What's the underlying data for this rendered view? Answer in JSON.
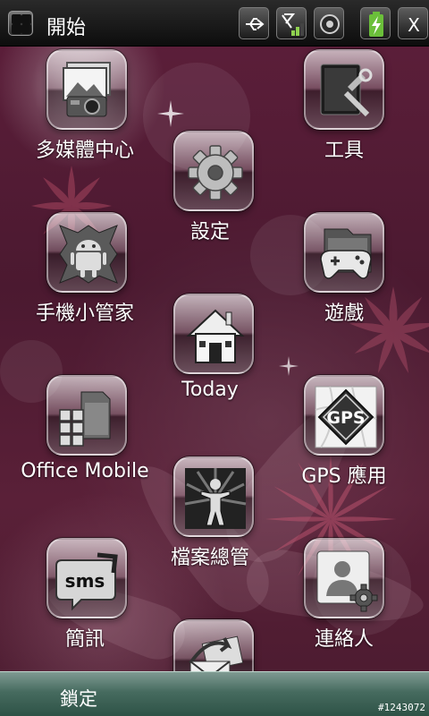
{
  "statusbar": {
    "title": "開始",
    "icons": [
      "start-icon",
      "usb-icon",
      "signal-off-icon",
      "speaker-icon",
      "battery-charging-icon",
      "close-icon"
    ],
    "close_label": "X"
  },
  "apps": [
    {
      "id": "multimedia",
      "label": "多媒體中心",
      "icon": "camera-photo-icon"
    },
    {
      "id": "tools",
      "label": "工具",
      "icon": "tools-icon"
    },
    {
      "id": "settings",
      "label": "設定",
      "icon": "gear-icon"
    },
    {
      "id": "phone-manager",
      "label": "手機小管家",
      "icon": "android-icon"
    },
    {
      "id": "games",
      "label": "遊戲",
      "icon": "gamepad-icon"
    },
    {
      "id": "today",
      "label": "Today",
      "icon": "home-icon"
    },
    {
      "id": "office-mobile",
      "label": "Office Mobile",
      "icon": "office-icon"
    },
    {
      "id": "gps",
      "label": "GPS 應用",
      "icon": "gps-icon"
    },
    {
      "id": "file-manager",
      "label": "檔案總管",
      "icon": "file-manager-icon"
    },
    {
      "id": "sms",
      "label": "簡訊",
      "icon": "sms-icon"
    },
    {
      "id": "contacts",
      "label": "連絡人",
      "icon": "contacts-icon"
    },
    {
      "id": "email",
      "label": "",
      "icon": "email-icon"
    }
  ],
  "sms_icon_text": "sms",
  "gps_icon_text": "GPS",
  "bottombar": {
    "lock_label": "鎖定"
  },
  "watermark": "#1243072"
}
